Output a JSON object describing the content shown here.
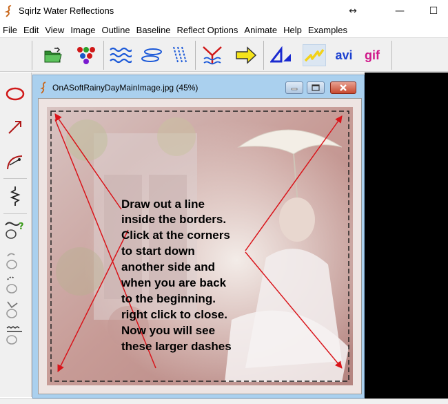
{
  "app": {
    "title": "Sqirlz Water Reflections"
  },
  "window_controls": {
    "resize_glyph": "↔",
    "minimize_glyph": "—",
    "maximize_glyph": "☐"
  },
  "menu": [
    "File",
    "Edit",
    "View",
    "Image",
    "Outline",
    "Baseline",
    "Reflect Options",
    "Animate",
    "Help",
    "Examples"
  ],
  "toolbar": {
    "avi_label": "avi",
    "gif_label": "gif",
    "icons": [
      "open-folder-icon",
      "color-dots-icon",
      "waves-icon",
      "ripples-icon",
      "rain-icon",
      "reflect-icon",
      "arrow-right-icon",
      "triangle-icon",
      "lightning-icon"
    ]
  },
  "left_tools": [
    "ellipse-icon",
    "arrow-line-icon",
    "curve-icon",
    "zigzag-icon",
    "outline-help-icon",
    "outline-tool-icon",
    "outline-dash-icon",
    "outline-tilt-icon",
    "outline-wave-icon"
  ],
  "image_window": {
    "title": "OnASoftRainyDayMainImage.jpg (45%)"
  },
  "annotation": {
    "lines": [
      "Draw out a line",
      "inside the borders.",
      "Click at the corners",
      "to start down",
      "another side and",
      "when you are back",
      "to the beginning.",
      "right click to close.",
      "Now you will see",
      "these larger dashes"
    ]
  },
  "colors": {
    "accent_red": "#d9141a",
    "toolbar_bg": "#f0f0f0",
    "child_frame": "#aad0ee",
    "workspace": "#000000"
  }
}
